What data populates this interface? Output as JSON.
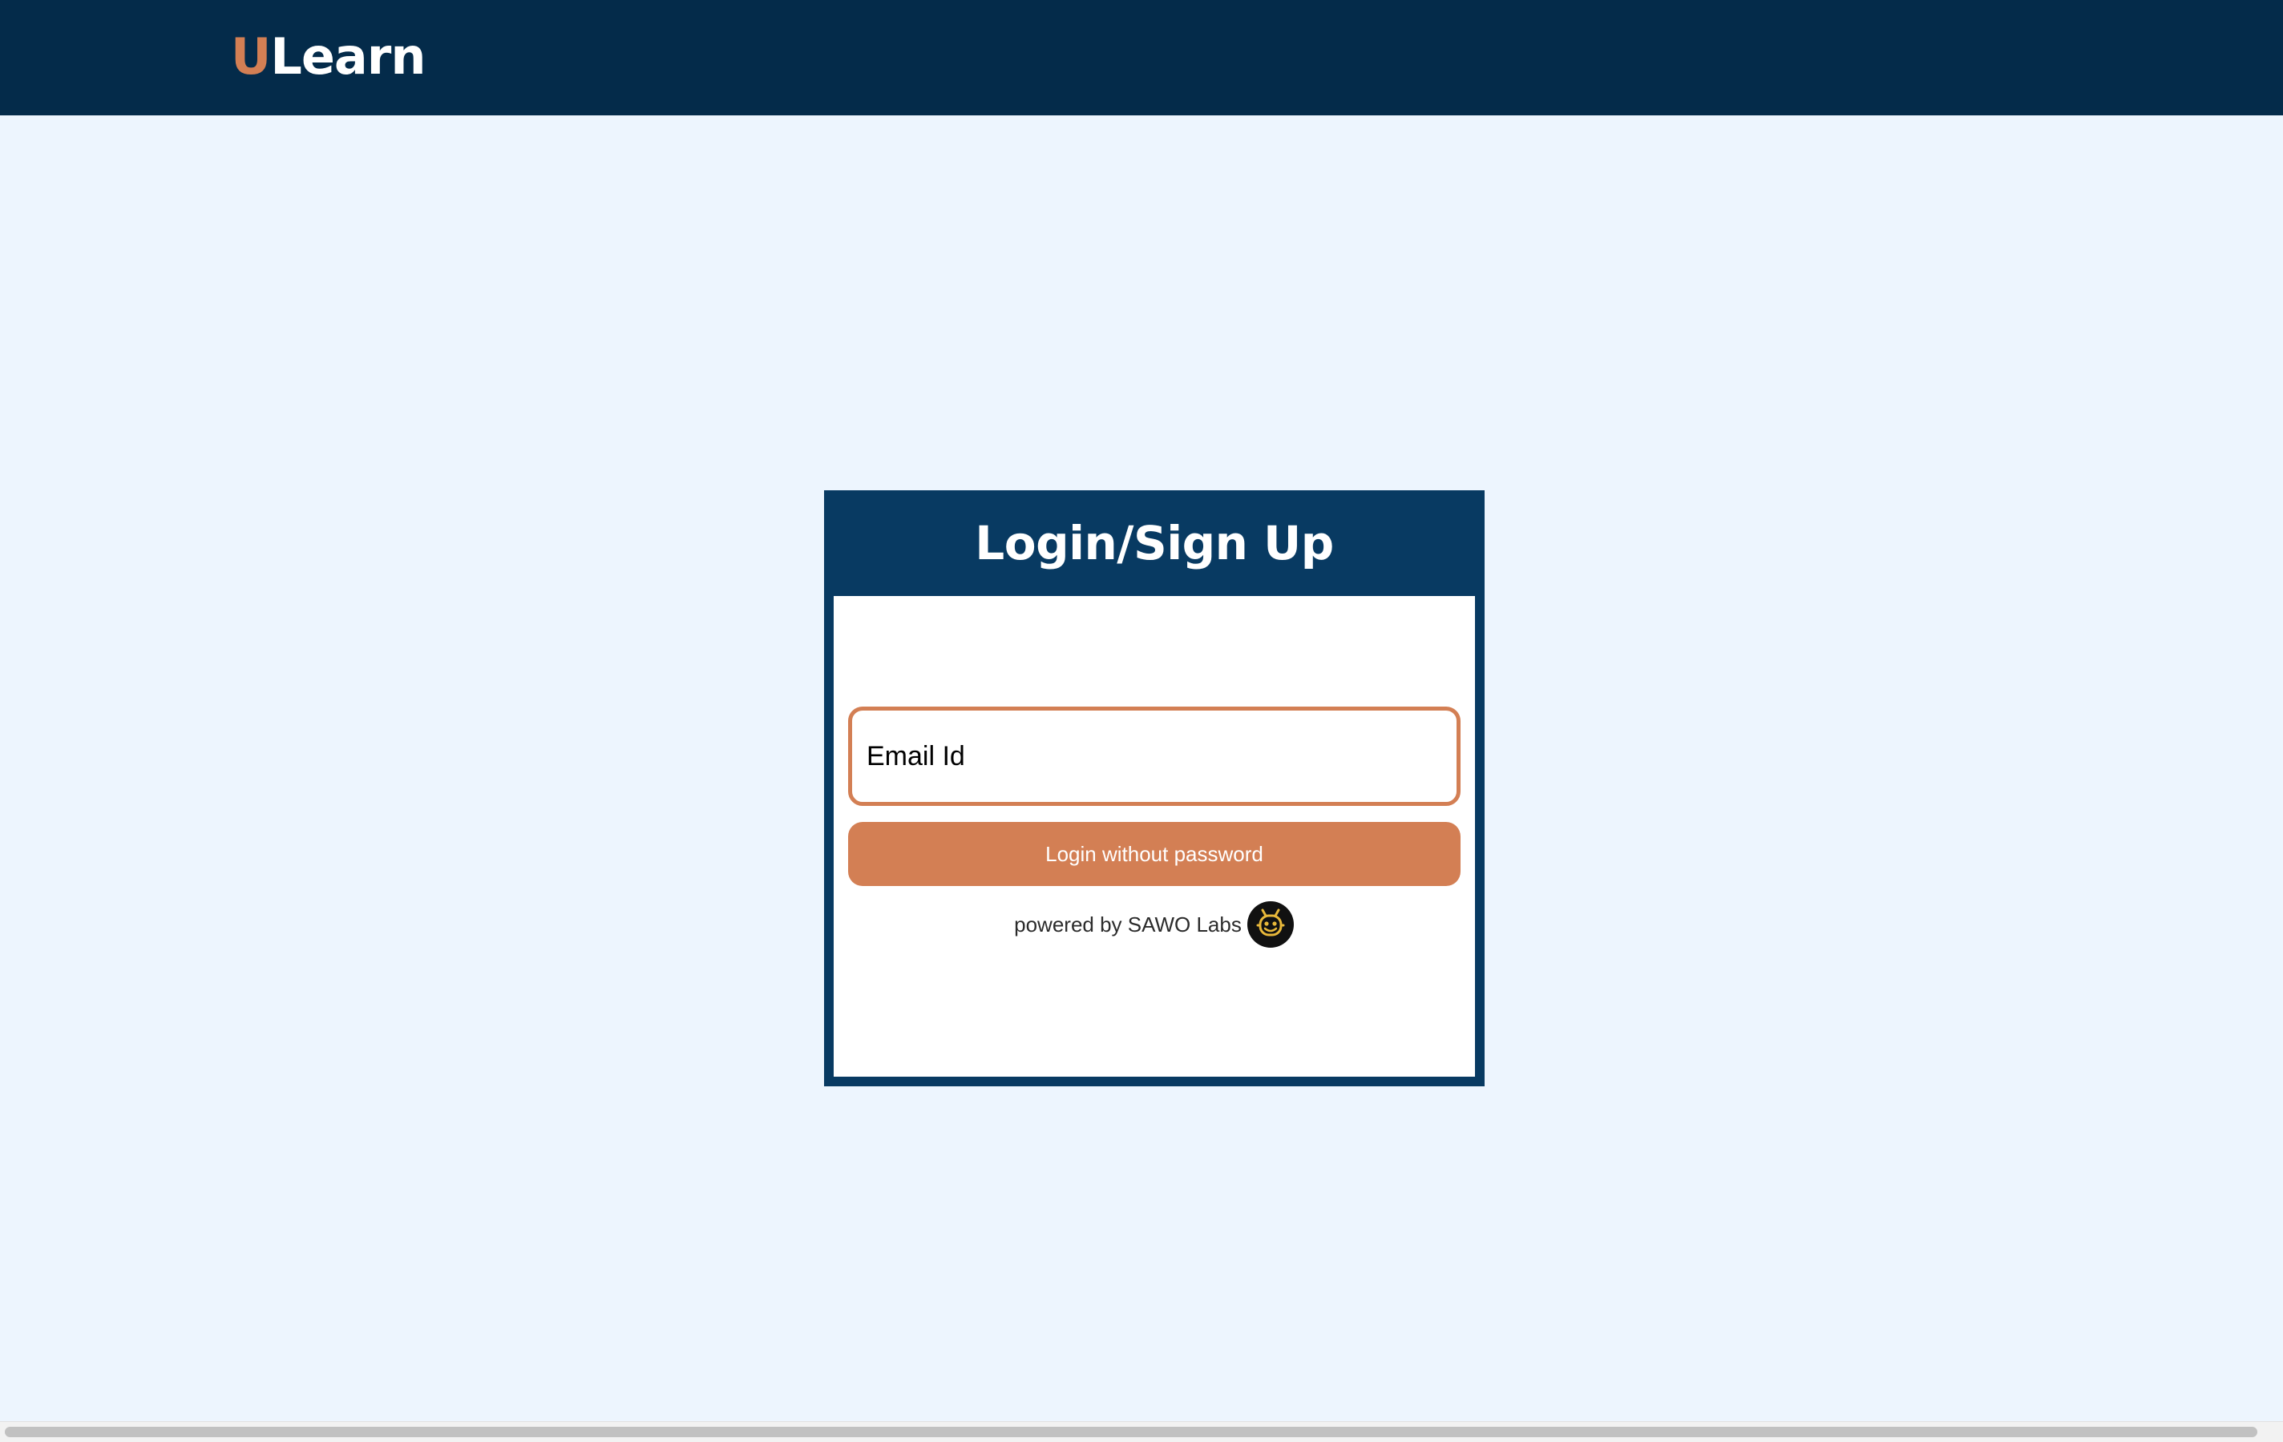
{
  "navbar": {
    "logo_accent": "U",
    "logo_rest": "Learn"
  },
  "login_card": {
    "title": "Login/Sign Up",
    "email_placeholder": "Email Id",
    "submit_label": "Login without password",
    "powered_by": "powered by SAWO Labs"
  },
  "colors": {
    "navbar": "#042B4A",
    "card_header": "#083A62",
    "accent": "#D37F54",
    "page_background": "#EDF5FE"
  },
  "icons": {
    "sawo_logo": "sawo-labs-logo"
  }
}
